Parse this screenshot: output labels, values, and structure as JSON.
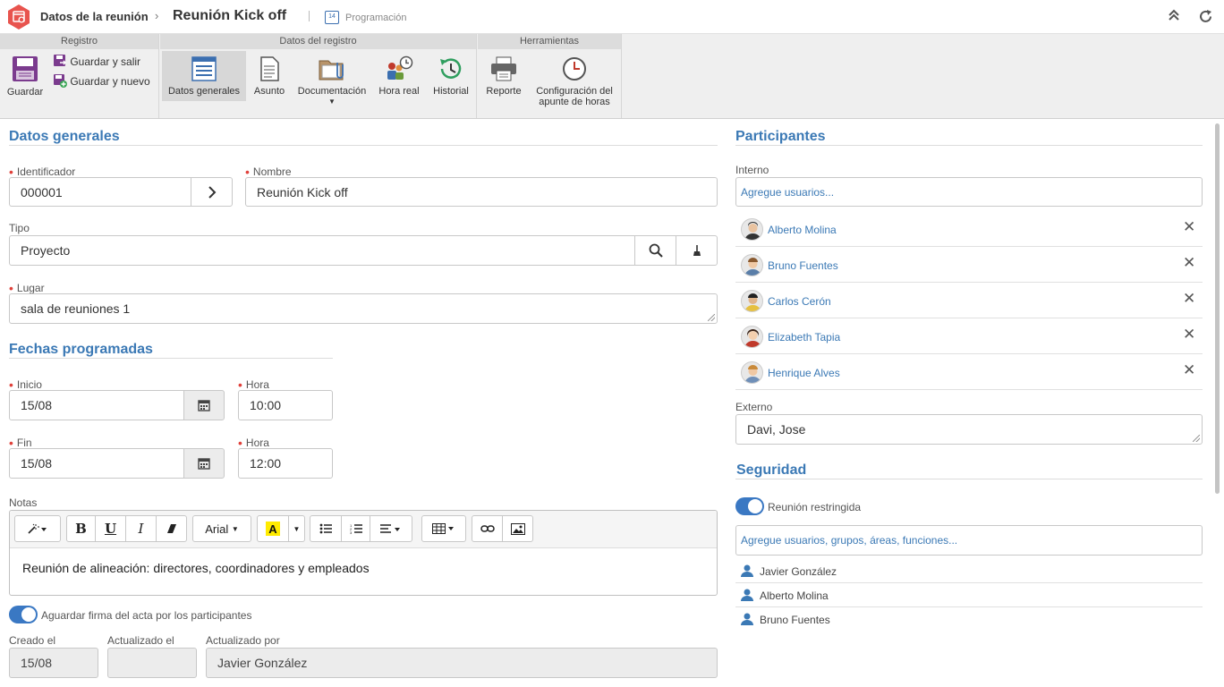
{
  "header": {
    "breadcrumb_parent": "Datos de la reunión",
    "breadcrumb_separator": "›",
    "title": "Reunión Kick off",
    "module_label": "Programación",
    "calendar_day": "14"
  },
  "ribbon": {
    "groups": {
      "registro": "Registro",
      "datos_registro": "Datos del registro",
      "herramientas": "Herramientas"
    },
    "buttons": {
      "guardar": "Guardar",
      "guardar_salir": "Guardar y salir",
      "guardar_nuevo": "Guardar y nuevo",
      "datos_generales": "Datos generales",
      "asunto": "Asunto",
      "documentacion": "Documentación",
      "hora_real": "Hora real",
      "historial": "Historial",
      "reporte": "Reporte",
      "config_line1": "Configuración del",
      "config_line2": "apunte de horas"
    }
  },
  "datos_generales": {
    "title": "Datos generales",
    "identificador_label": "Identificador",
    "identificador_value": "000001",
    "nombre_label": "Nombre",
    "nombre_value": "Reunión Kick off",
    "tipo_label": "Tipo",
    "tipo_value": "Proyecto",
    "lugar_label": "Lugar",
    "lugar_value": "sala de reuniones 1"
  },
  "fechas": {
    "title": "Fechas programadas",
    "inicio_label": "Inicio",
    "inicio_value": "15/08",
    "hora_inicio_label": "Hora",
    "hora_inicio_value": "10:00",
    "fin_label": "Fin",
    "fin_value": "15/08",
    "hora_fin_label": "Hora",
    "hora_fin_value": "12:00"
  },
  "notas": {
    "label": "Notas",
    "font_select": "Arial",
    "content": "Reunión de alineación: directores, coordinadores y empleados"
  },
  "footer": {
    "toggle_label": "Aguardar firma del acta por los participantes",
    "creado_label": "Creado el",
    "creado_value": "15/08",
    "actualizado_label": "Actualizado el",
    "actualizado_value": "",
    "actualizado_por_label": "Actualizado por",
    "actualizado_por_value": "Javier González"
  },
  "participantes": {
    "title": "Participantes",
    "interno_label": "Interno",
    "interno_placeholder": "Agregue usuarios...",
    "items": [
      {
        "name": "Alberto Molina",
        "remove": "✕"
      },
      {
        "name": "Bruno Fuentes",
        "remove": "✕"
      },
      {
        "name": "Carlos Cerón",
        "remove": "✕"
      },
      {
        "name": "Elizabeth Tapia",
        "remove": "✕"
      },
      {
        "name": "Henrique Alves",
        "remove": "✕"
      }
    ],
    "externo_label": "Externo",
    "externo_value": "Davi, Jose"
  },
  "seguridad": {
    "title": "Seguridad",
    "toggle_label": "Reunión restringida",
    "placeholder": "Agregue usuarios, grupos, áreas, funciones...",
    "users": [
      "Javier González",
      "Alberto Molina",
      "Bruno Fuentes"
    ]
  },
  "colors": {
    "accent": "#3b79b5",
    "toggle": "#3a78c3",
    "required": "#e0403a",
    "app_icon": "#e8544e"
  }
}
